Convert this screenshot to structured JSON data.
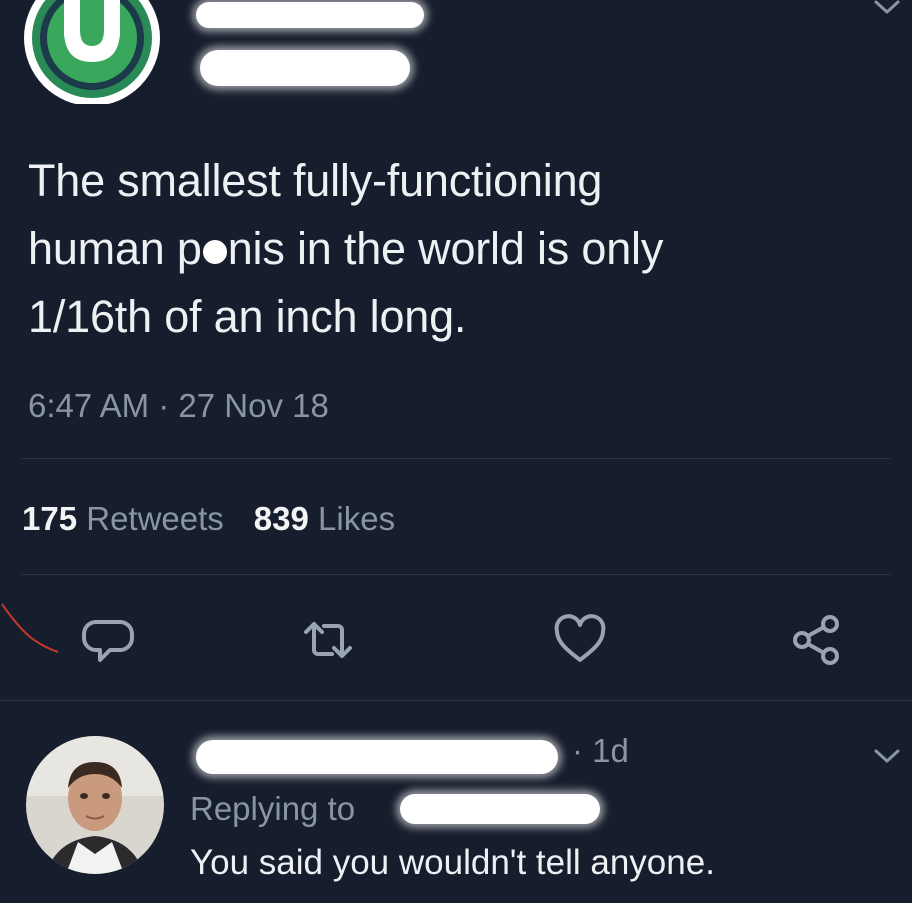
{
  "tweet": {
    "text_line1": "The smallest fully-functioning",
    "text_line2_a": "human p",
    "text_line2_b": "nis in the world is only",
    "text_line3": "1/16th of an inch long.",
    "timestamp": "6:47 AM · 27 Nov 18",
    "retweets_count": "175",
    "retweets_label": "Retweets",
    "likes_count": "839",
    "likes_label": "Likes"
  },
  "icons": {
    "logo": "u-umlaut-logo-icon",
    "reply": "speech-bubble-icon",
    "retweet": "retweet-arrows-icon",
    "like": "heart-icon",
    "share": "share-nodes-icon",
    "menu": "chevron-down-icon"
  },
  "reply": {
    "time": "· 1d",
    "replying_label": "Replying to",
    "text": "You said you wouldn't tell anyone."
  },
  "colors": {
    "background": "#161d2c",
    "text_primary": "#eef1f4",
    "text_secondary": "#8a95a3",
    "logo_green": "#3aa85c",
    "logo_navy": "#1b3b4b"
  }
}
